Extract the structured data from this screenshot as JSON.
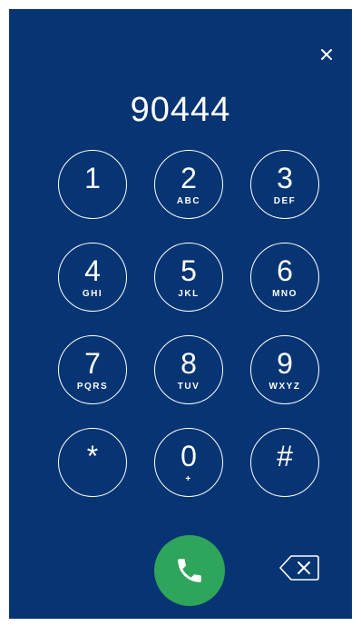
{
  "dialer": {
    "number": "90444",
    "keys": [
      {
        "digit": "1",
        "letters": ""
      },
      {
        "digit": "2",
        "letters": "ABC"
      },
      {
        "digit": "3",
        "letters": "DEF"
      },
      {
        "digit": "4",
        "letters": "GHI"
      },
      {
        "digit": "5",
        "letters": "JKL"
      },
      {
        "digit": "6",
        "letters": "MNO"
      },
      {
        "digit": "7",
        "letters": "PQRS"
      },
      {
        "digit": "8",
        "letters": "TUV"
      },
      {
        "digit": "9",
        "letters": "WXYZ"
      },
      {
        "digit": "*",
        "letters": ""
      },
      {
        "digit": "0",
        "letters": "+"
      },
      {
        "digit": "#",
        "letters": ""
      }
    ]
  },
  "icons": {
    "close": "close-icon",
    "call": "phone-icon",
    "backspace": "backspace-icon"
  },
  "colors": {
    "background": "#073472",
    "call_button": "#2ea55a",
    "foreground": "#ffffff"
  }
}
